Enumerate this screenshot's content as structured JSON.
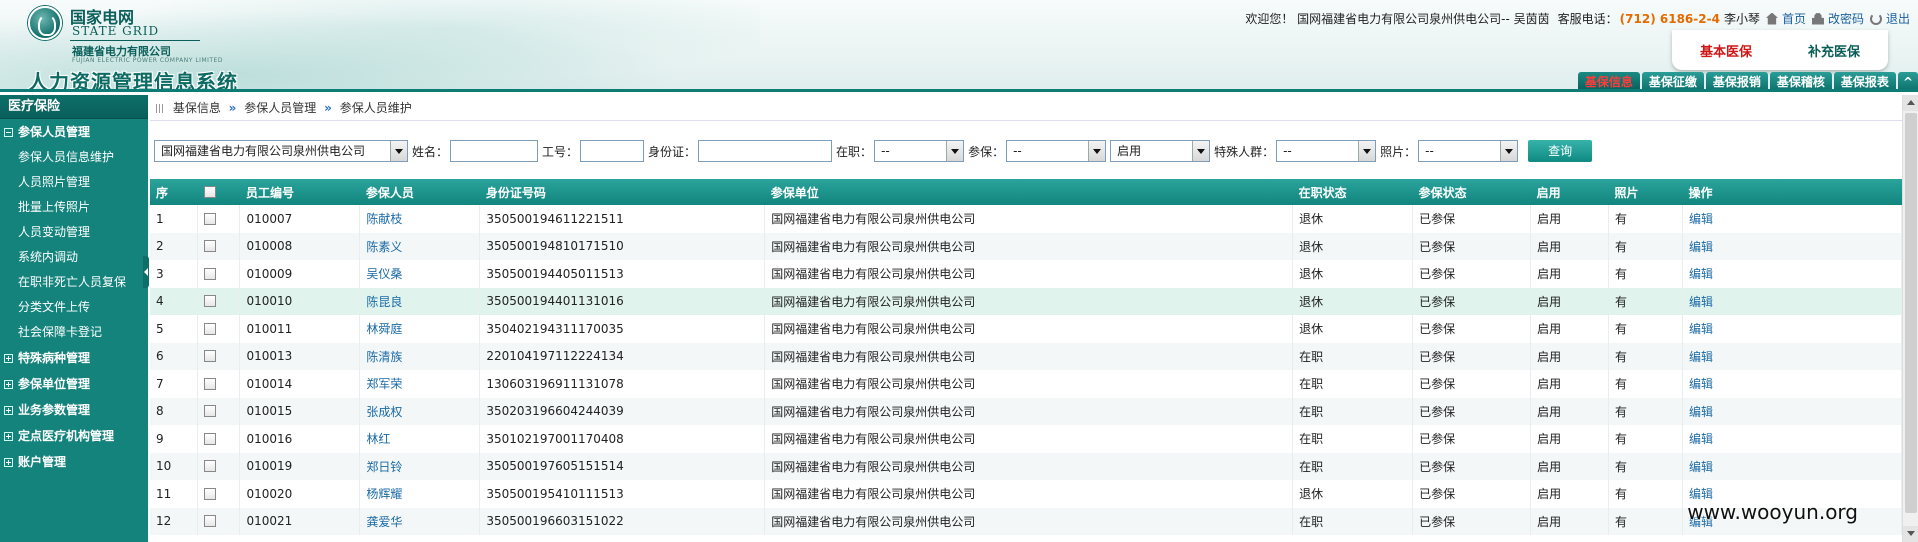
{
  "brand": {
    "cn": "国家电网",
    "en": "STATE GRID",
    "sub": "福建省电力有限公司",
    "sub_en": "FUJIAN ELECTRIC POWER COMPANY LIMITED",
    "system_title": "人力资源管理信息系统"
  },
  "topbar": {
    "welcome": "欢迎您！ 国网福建省电力有限公司泉州供电公司-- 吴茵茵",
    "phone_label": "客服电话：",
    "phone": "(712) 6186-2-4",
    "contact": "李小琴",
    "home": "首页",
    "change_pwd": "改密码",
    "logout": "退出"
  },
  "insurance_types": {
    "basic": "基本医保",
    "supplement": "补充医保"
  },
  "main_nav": [
    "基保信息",
    "基保征缴",
    "基保报销",
    "基保稽核",
    "基保报表"
  ],
  "sidebar": {
    "header": "医疗保险",
    "groups": [
      {
        "label": "参保人员管理",
        "expanded": true,
        "items": [
          "参保人员信息维护",
          "人员照片管理",
          "批量上传照片",
          "人员变动管理",
          "系统内调动",
          "在职非死亡人员复保",
          "分类文件上传",
          "社会保障卡登记"
        ]
      },
      {
        "label": "特殊病种管理"
      },
      {
        "label": "参保单位管理"
      },
      {
        "label": "业务参数管理"
      },
      {
        "label": "定点医疗机构管理"
      },
      {
        "label": "账户管理"
      }
    ]
  },
  "breadcrumb": [
    "基保信息",
    "参保人员管理",
    "参保人员维护"
  ],
  "filters": {
    "unit": "国网福建省电力有限公司泉州供电公司",
    "name_label": "姓名：",
    "id_label": "工号：",
    "idcard_label": "身份证：",
    "onjob_label": "在职：",
    "onjob_value": "--",
    "insured_label": "参保：",
    "insured_value": "--",
    "enabled_value": "启用",
    "special_label": "特殊人群：",
    "special_value": "--",
    "photo_label": "照片：",
    "photo_value": "--",
    "query": "查询"
  },
  "table": {
    "headers": [
      "序",
      "",
      "员工编号",
      "参保人员",
      "身份证号码",
      "参保单位",
      "在职状态",
      "参保状态",
      "启用",
      "照片",
      "操作"
    ],
    "rows": [
      [
        "1",
        "010007",
        "陈献枝",
        "350500194611221511",
        "国网福建省电力有限公司泉州供电公司",
        "退休",
        "已参保",
        "启用",
        "有",
        "编辑"
      ],
      [
        "2",
        "010008",
        "陈素义",
        "350500194810171510",
        "国网福建省电力有限公司泉州供电公司",
        "退休",
        "已参保",
        "启用",
        "有",
        "编辑"
      ],
      [
        "3",
        "010009",
        "吴仪桑",
        "350500194405011513",
        "国网福建省电力有限公司泉州供电公司",
        "退休",
        "已参保",
        "启用",
        "有",
        "编辑"
      ],
      [
        "4",
        "010010",
        "陈昆良",
        "350500194401131016",
        "国网福建省电力有限公司泉州供电公司",
        "退休",
        "已参保",
        "启用",
        "有",
        "编辑"
      ],
      [
        "5",
        "010011",
        "林舜庭",
        "350402194311170035",
        "国网福建省电力有限公司泉州供电公司",
        "退休",
        "已参保",
        "启用",
        "有",
        "编辑"
      ],
      [
        "6",
        "010013",
        "陈清族",
        "220104197112224134",
        "国网福建省电力有限公司泉州供电公司",
        "在职",
        "已参保",
        "启用",
        "有",
        "编辑"
      ],
      [
        "7",
        "010014",
        "郑军荣",
        "130603196911131078",
        "国网福建省电力有限公司泉州供电公司",
        "在职",
        "已参保",
        "启用",
        "有",
        "编辑"
      ],
      [
        "8",
        "010015",
        "张成权",
        "350203196604244039",
        "国网福建省电力有限公司泉州供电公司",
        "在职",
        "已参保",
        "启用",
        "有",
        "编辑"
      ],
      [
        "9",
        "010016",
        "林红",
        "350102197001170408",
        "国网福建省电力有限公司泉州供电公司",
        "在职",
        "已参保",
        "启用",
        "有",
        "编辑"
      ],
      [
        "10",
        "010019",
        "郑日铃",
        "350500197605151514",
        "国网福建省电力有限公司泉州供电公司",
        "在职",
        "已参保",
        "启用",
        "有",
        "编辑"
      ],
      [
        "11",
        "010020",
        "杨辉耀",
        "350500195410111513",
        "国网福建省电力有限公司泉州供电公司",
        "退休",
        "已参保",
        "启用",
        "有",
        "编辑"
      ],
      [
        "12",
        "010021",
        "龚爱华",
        "350500196603151022",
        "国网福建省电力有限公司泉州供电公司",
        "在职",
        "已参保",
        "启用",
        "有",
        "编辑"
      ]
    ]
  },
  "watermark": "www.wooyun.org",
  "colors": {
    "primary": "#13837c",
    "header_accent": "#0e7c76",
    "phone": "#e46b00",
    "active_nav": "#ff3b3b",
    "link": "#1b6aa5"
  }
}
